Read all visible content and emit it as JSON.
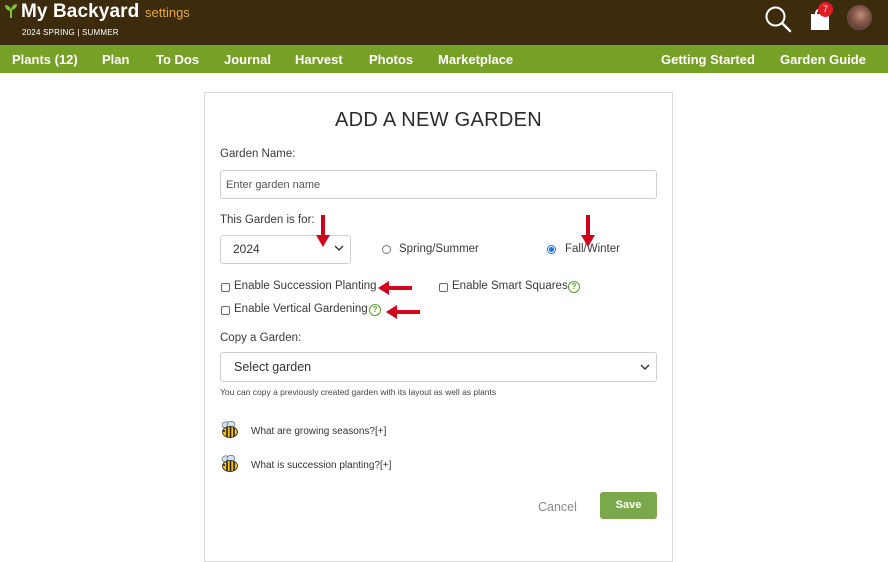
{
  "header": {
    "app_title": "My Backyard",
    "settings_link": "settings",
    "season": "2024 SPRING | SUMMER",
    "cart_count": "7",
    "icons": [
      "sprout-icon",
      "search-icon",
      "shopping-bag-icon",
      "avatar"
    ]
  },
  "nav": {
    "plants": "Plants (12)",
    "plan": "Plan",
    "todos": "To Dos",
    "journal": "Journal",
    "harvest": "Harvest",
    "photos": "Photos",
    "marketplace": "Marketplace",
    "getting_started": "Getting Started",
    "garden_guide": "Garden Guide"
  },
  "form": {
    "title": "ADD A NEW GARDEN",
    "garden_name_label": "Garden Name:",
    "garden_name_value": "",
    "garden_name_placeholder": "Enter garden name",
    "garden_for_label": "This Garden is for:",
    "year_selected": "2024",
    "season_options": [
      {
        "label": "Spring/Summer",
        "selected": false
      },
      {
        "label": "Fall/Winter",
        "selected": true
      }
    ],
    "enable_succession": "Enable Succession Planting",
    "enable_smart_squares": "Enable Smart Squares",
    "enable_vertical": "Enable Vertical Gardening",
    "copy_label": "Copy a Garden:",
    "copy_selected": "Select garden",
    "copy_hint": "You can copy a previously created garden with its layout as well as plants",
    "faq1": "What are growing seasons?[+]",
    "faq2": "What is succession planting?[+]",
    "cancel": "Cancel",
    "save": "Save"
  },
  "colors": {
    "header_bg": "#3d2b0e",
    "nav_bg": "#76a026",
    "settings_accent": "#f0a73a",
    "save_bg": "#7aa84b",
    "annotation_arrow": "#d0021b",
    "badge": "#e31b23"
  }
}
